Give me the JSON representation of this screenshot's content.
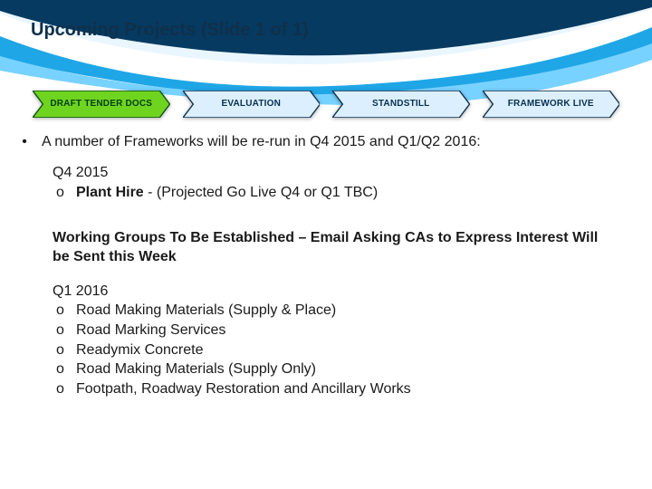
{
  "title": "Upcoming Projects (Slide 1 of 1)",
  "stages": [
    {
      "label": "DRAFT TENDER DOCS",
      "kind": "green"
    },
    {
      "label": "EVALUATION",
      "kind": "blue"
    },
    {
      "label": "STANDSTILL",
      "kind": "blue"
    },
    {
      "label": "FRAMEWORK LIVE",
      "kind": "blue"
    }
  ],
  "main_bullet": "A number of Frameworks will be re-run in Q4 2015 and Q1/Q2 2016:",
  "q4": {
    "heading": "Q4 2015",
    "items": [
      {
        "bold": "Plant Hire",
        "rest": " - (Projected Go Live Q4 or Q1 TBC)"
      }
    ]
  },
  "working_groups_note": "Working Groups To Be Established – Email Asking CAs to Express Interest Will be Sent this Week",
  "q1": {
    "heading": "Q1 2016",
    "items": [
      "Road Making Materials (Supply & Place)",
      "Road Marking Services",
      "Readymix Concrete",
      "Road Making Materials (Supply Only)",
      "Footpath, Roadway Restoration and Ancillary Works"
    ]
  },
  "colors": {
    "green_fill": "#6fd41f",
    "green_stroke": "#0d4f14",
    "blue_fill": "#dcefff",
    "blue_stroke": "#0b2e4d"
  }
}
